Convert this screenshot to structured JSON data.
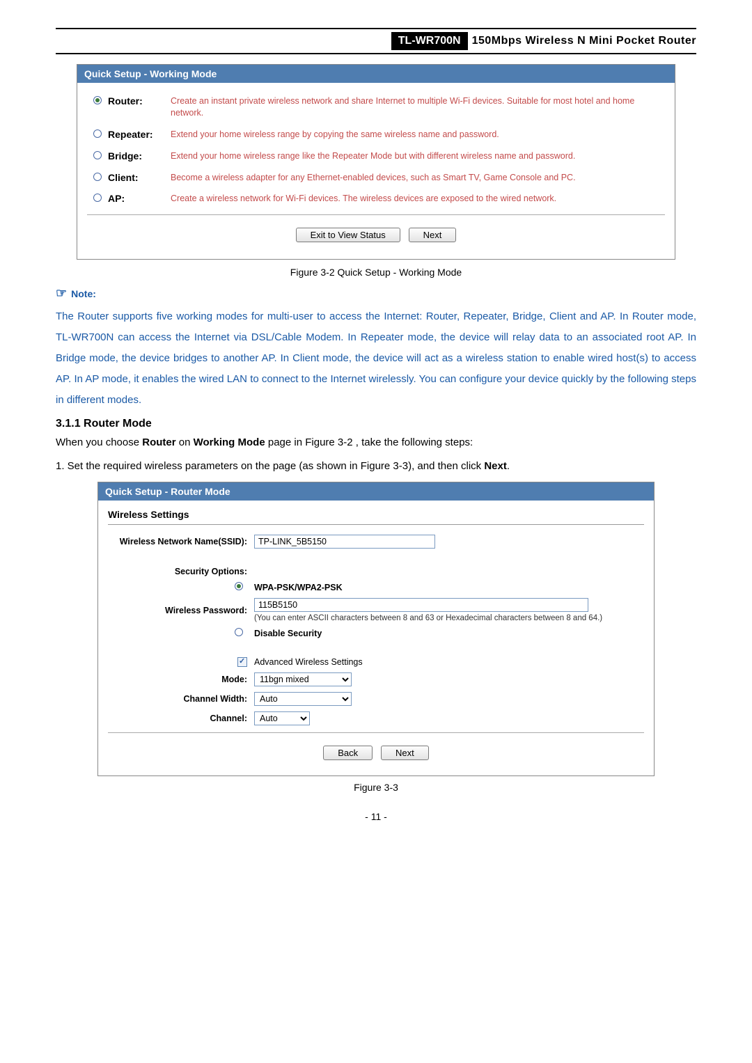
{
  "header": {
    "model": "TL-WR700N",
    "desc": "150Mbps  Wireless  N  Mini  Pocket  Router"
  },
  "panel1": {
    "title": "Quick Setup - Working Mode",
    "modes": [
      {
        "label": "Router:",
        "selected": true,
        "desc": "Create an instant private wireless network and share Internet to multiple Wi-Fi devices. Suitable for most hotel and home network."
      },
      {
        "label": "Repeater:",
        "selected": false,
        "desc": "Extend your home wireless range by copying the same wireless name and password."
      },
      {
        "label": "Bridge:",
        "selected": false,
        "desc": "Extend your home wireless range like the Repeater Mode but with different wireless name and password."
      },
      {
        "label": "Client:",
        "selected": false,
        "desc": "Become a wireless adapter for any Ethernet-enabled devices, such as Smart TV, Game Console and PC."
      },
      {
        "label": "AP:",
        "selected": false,
        "desc": "Create a wireless network for Wi-Fi devices. The wireless devices are exposed to the wired network."
      }
    ],
    "btn_exit": "Exit to View Status",
    "btn_next": "Next",
    "caption": "Figure 3-2 Quick Setup - Working Mode"
  },
  "note": {
    "label": "Note:",
    "body": "The Router supports five working modes for multi-user to access the Internet: Router, Repeater, Bridge, Client and AP. In Router mode, TL-WR700N can access the Internet via DSL/Cable Modem. In Repeater mode, the device will relay data to an associated root AP. In Bridge mode, the device bridges to another AP. In Client mode, the device will act as a wireless station to enable wired host(s) to access AP. In AP mode, it enables the wired LAN to connect to the Internet wirelessly. You can configure your device quickly by the following steps in different modes."
  },
  "section": {
    "heading": "3.1.1  Router Mode",
    "intro_pre": "When you choose ",
    "intro_b1": "Router",
    "intro_mid": " on ",
    "intro_b2": "Working Mode",
    "intro_post": " page in Figure 3-2 , take the following steps:",
    "step1_pre": "1.    Set the required wireless parameters on the page (as shown in Figure 3-3), and then click ",
    "step1_bold": "Next",
    "step1_post": "."
  },
  "panel2": {
    "title": "Quick Setup - Router Mode",
    "subhead": "Wireless Settings",
    "ssid_label": "Wireless Network Name(SSID):",
    "ssid_value": "TP-LINK_5B5150",
    "sec_options_label": "Security Options:",
    "sec_wpa_label": "WPA-PSK/WPA2-PSK",
    "pwd_label": "Wireless Password:",
    "pwd_value": "115B5150",
    "pwd_help": "(You can enter ASCII characters between 8 and 63 or Hexadecimal characters between 8 and 64.)",
    "disable_label": "Disable Security",
    "adv_label": "Advanced Wireless Settings",
    "mode_label": "Mode:",
    "mode_value": "11bgn mixed",
    "chwidth_label": "Channel Width:",
    "chwidth_value": "Auto",
    "channel_label": "Channel:",
    "channel_value": "Auto",
    "btn_back": "Back",
    "btn_next": "Next",
    "caption": "Figure 3-3"
  },
  "page_number": "- 11 -",
  "chart_data": null
}
